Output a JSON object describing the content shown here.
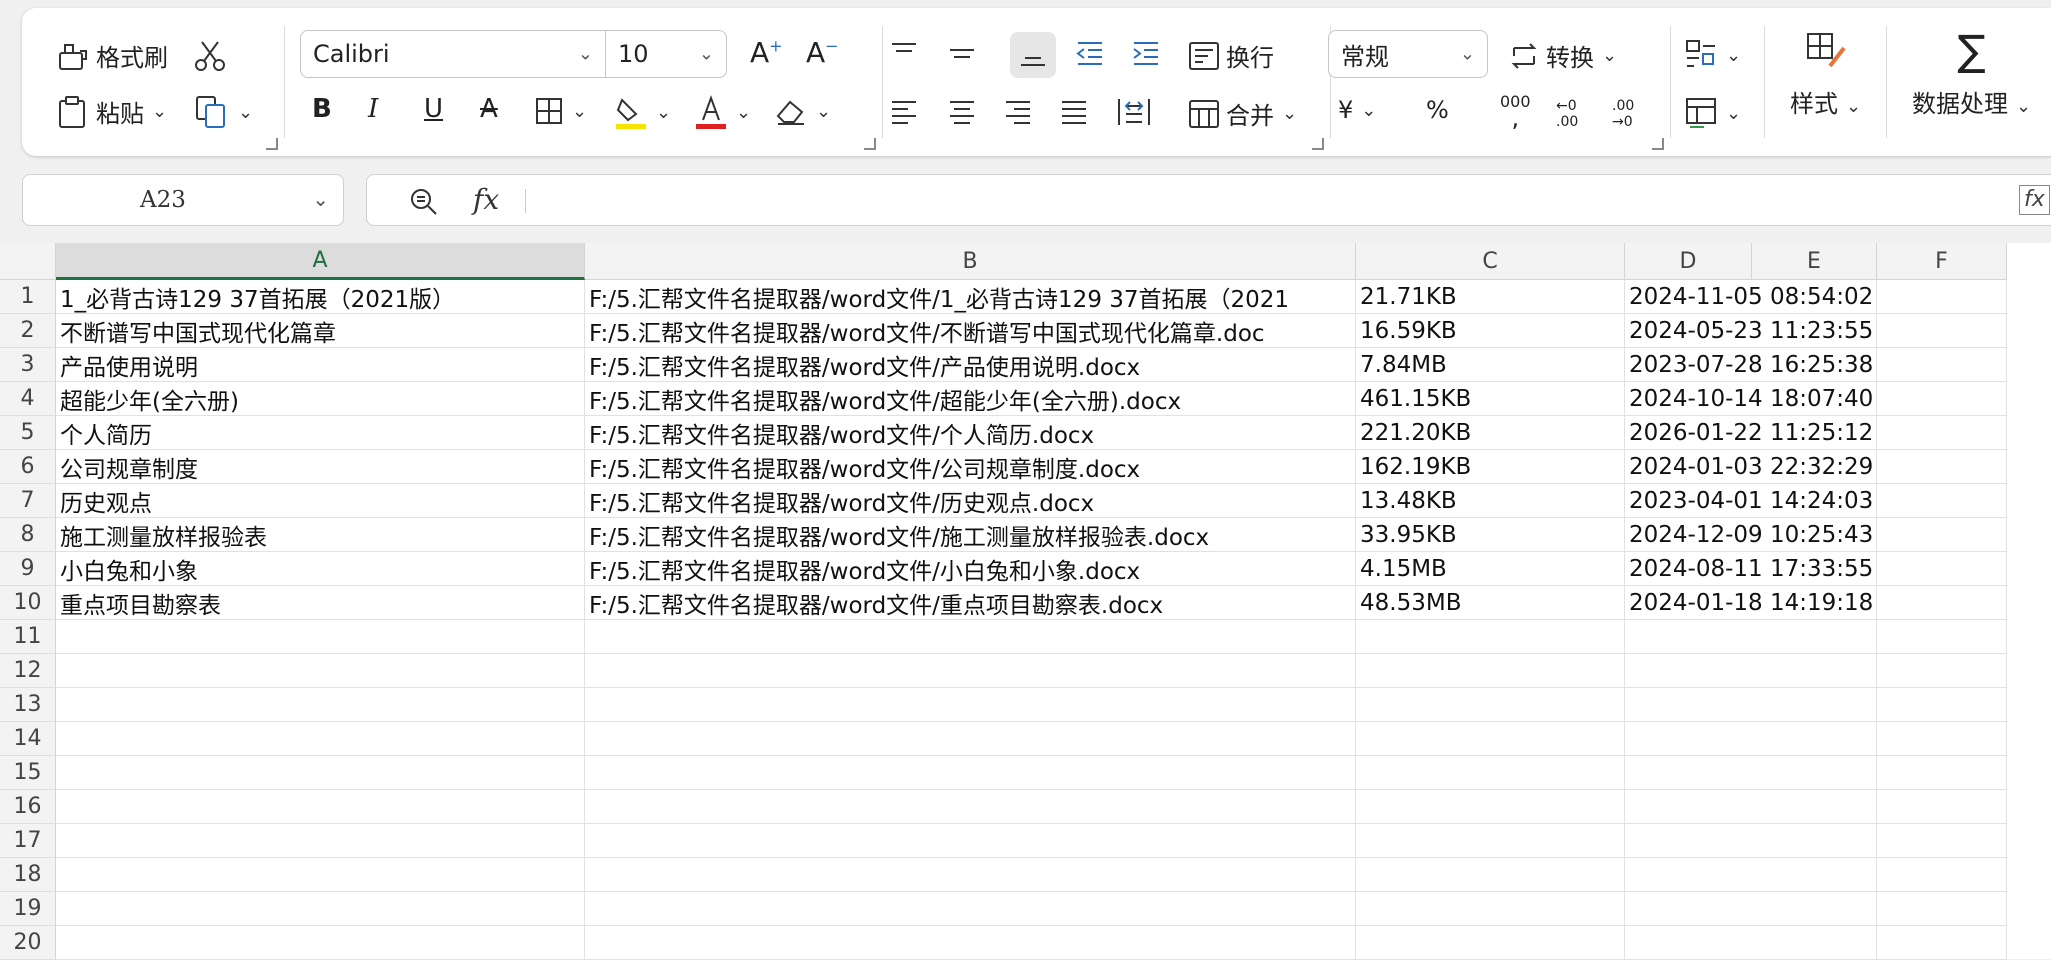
{
  "ribbon": {
    "format_painter": "格式刷",
    "paste": "粘贴",
    "font_name": "Calibri",
    "font_size": "10",
    "wrap_text": "换行",
    "merge": "合并",
    "number_format": "常规",
    "convert": "转换",
    "styles": "样式",
    "data_processing": "数据处理",
    "currency_symbol": "¥",
    "percent_symbol": "%",
    "thousands_symbol": "000",
    "decrease_decimal": "←0 .00",
    "increase_decimal": ".00 →0",
    "colors": {
      "fill_accent": "#f5e400",
      "font_accent": "#e02020"
    }
  },
  "formula_bar": {
    "name_box": "A23",
    "fx_label": "fx",
    "content": ""
  },
  "sheet": {
    "columns": [
      "A",
      "B",
      "C",
      "D",
      "E",
      "F"
    ],
    "active_column": "A",
    "row_numbers": [
      "1",
      "2",
      "3",
      "4",
      "5",
      "6",
      "7",
      "8",
      "9",
      "10",
      "11",
      "12",
      "13",
      "14",
      "15",
      "16",
      "17",
      "18",
      "19",
      "20"
    ],
    "rows": [
      [
        "1_必背古诗129 37首拓展（2021版）",
        "F:/5.汇帮文件名提取器/word文件/1_必背古诗129 37首拓展（2021",
        "21.71KB",
        "2024-11-05 08:54:02"
      ],
      [
        "不断谱写中国式现代化篇章",
        "F:/5.汇帮文件名提取器/word文件/不断谱写中国式现代化篇章.doc",
        "16.59KB",
        "2024-05-23 11:23:55"
      ],
      [
        "产品使用说明",
        "F:/5.汇帮文件名提取器/word文件/产品使用说明.docx",
        "7.84MB",
        "2023-07-28 16:25:38"
      ],
      [
        "超能少年(全六册)",
        "F:/5.汇帮文件名提取器/word文件/超能少年(全六册).docx",
        "461.15KB",
        "2024-10-14 18:07:40"
      ],
      [
        "个人简历",
        "F:/5.汇帮文件名提取器/word文件/个人简历.docx",
        "221.20KB",
        "2026-01-22 11:25:12"
      ],
      [
        "公司规章制度",
        "F:/5.汇帮文件名提取器/word文件/公司规章制度.docx",
        "162.19KB",
        "2024-01-03 22:32:29"
      ],
      [
        "历史观点",
        "F:/5.汇帮文件名提取器/word文件/历史观点.docx",
        "13.48KB",
        "2023-04-01 14:24:03"
      ],
      [
        "施工测量放样报验表",
        "F:/5.汇帮文件名提取器/word文件/施工测量放样报验表.docx",
        "33.95KB",
        "2024-12-09 10:25:43"
      ],
      [
        "小白兔和小象",
        "F:/5.汇帮文件名提取器/word文件/小白兔和小象.docx",
        "4.15MB",
        "2024-08-11 17:33:55"
      ],
      [
        "重点项目勘察表",
        "F:/5.汇帮文件名提取器/word文件/重点项目勘察表.docx",
        "48.53MB",
        "2024-01-18 14:19:18"
      ]
    ]
  }
}
